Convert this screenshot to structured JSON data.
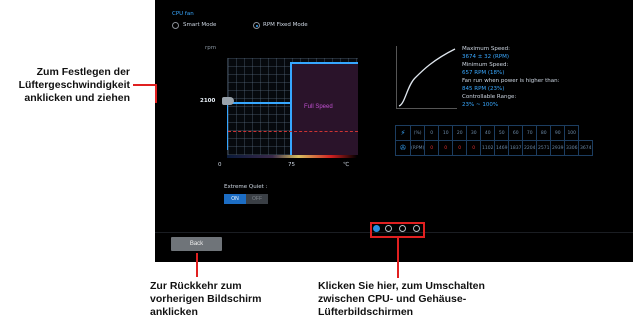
{
  "panel": {
    "title": "CPU fan",
    "modes": [
      {
        "label": "Smart Mode",
        "selected": false
      },
      {
        "label": "RPM Fixed Mode",
        "selected": true
      }
    ],
    "graph": {
      "y_unit": "rpm",
      "value": "2100",
      "x_start": "0",
      "x_mid": "75",
      "x_unit": "℃",
      "zone_label": "Full Speed"
    },
    "info": {
      "max_label": "Maximum Speed:",
      "max_value": "3674 ± 32 (RPM)",
      "min_label": "Minimum Speed:",
      "min_value": "657 RPM (18%)",
      "run_label": "Fan run when power is higher than:",
      "run_value": "845 RPM (23%)",
      "range_label": "Controllable Range:",
      "range_value": "23% ~ 100%"
    },
    "table": {
      "row1_unit": "(%)",
      "row1": [
        "0",
        "10",
        "20",
        "30",
        "40",
        "50",
        "60",
        "70",
        "80",
        "90",
        "100"
      ],
      "row2_unit": "(RPM)",
      "row2": [
        "0",
        "0",
        "0",
        "0",
        "1102",
        "1469",
        "1837",
        "2204",
        "2571",
        "2939",
        "3306",
        "3674"
      ]
    },
    "extreme_quiet": {
      "label": "Extreme Quiet :",
      "on": "ON",
      "off": "OFF"
    },
    "back_label": "Back",
    "pager": {
      "count": 4,
      "active": 1
    }
  },
  "annotations": {
    "slider": [
      "Zum Festlegen der",
      "Lüftergeschwindigkeit",
      "anklicken und ziehen"
    ],
    "back": [
      "Zur Rückkehr zum",
      "vorherigen Bildschirm",
      "anklicken"
    ],
    "pager": [
      "Klicken Sie hier, zum Umschalten",
      "zwischen CPU- und Gehäuse-",
      "Lüfterbildschirmen"
    ]
  },
  "colors": {
    "accent": "#39a8ff",
    "highlight": "#e02020",
    "zone": "#c050d0"
  }
}
